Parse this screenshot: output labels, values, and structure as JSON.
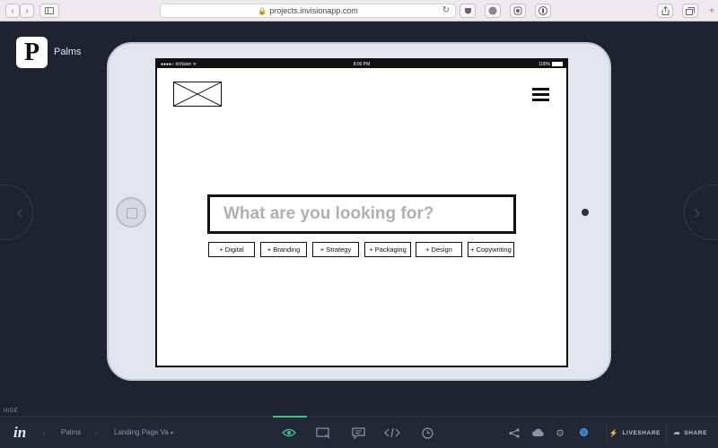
{
  "browser": {
    "url": "projects.invisionapp.com",
    "icons": [
      "back-icon",
      "forward-icon",
      "sidebar-icon",
      "lock-icon",
      "reload-icon",
      "pocket-icon",
      "abp-icon",
      "extension-icon",
      "onepassword-icon",
      "share-icon",
      "tabs-icon",
      "new-tab-icon"
    ]
  },
  "project": {
    "logo_letter": "P",
    "name": "Palms"
  },
  "device": {
    "status_left": "●●●●○ InVision ᯤ",
    "status_time": "8:00 PM",
    "status_battery": "100%"
  },
  "prototype": {
    "search_placeholder": "What are you looking for?",
    "tags": [
      "+ Digital",
      "+ Branding",
      "+ Strategy",
      "+ Packaging",
      "+ Design",
      "+ Copywriting"
    ]
  },
  "footer": {
    "hide_label": "HIDE",
    "logo": "in",
    "crumb_project": "Palms",
    "crumb_screen": "Landing Page Va",
    "tools": [
      "preview-eye-icon",
      "comment-mode-icon",
      "comment-icon",
      "inspect-code-icon",
      "history-icon"
    ],
    "liveshare_label": "LIVESHARE",
    "share_label": "SHARE",
    "accent_color": "#3fc37f",
    "status_color": "#2b79c9"
  }
}
